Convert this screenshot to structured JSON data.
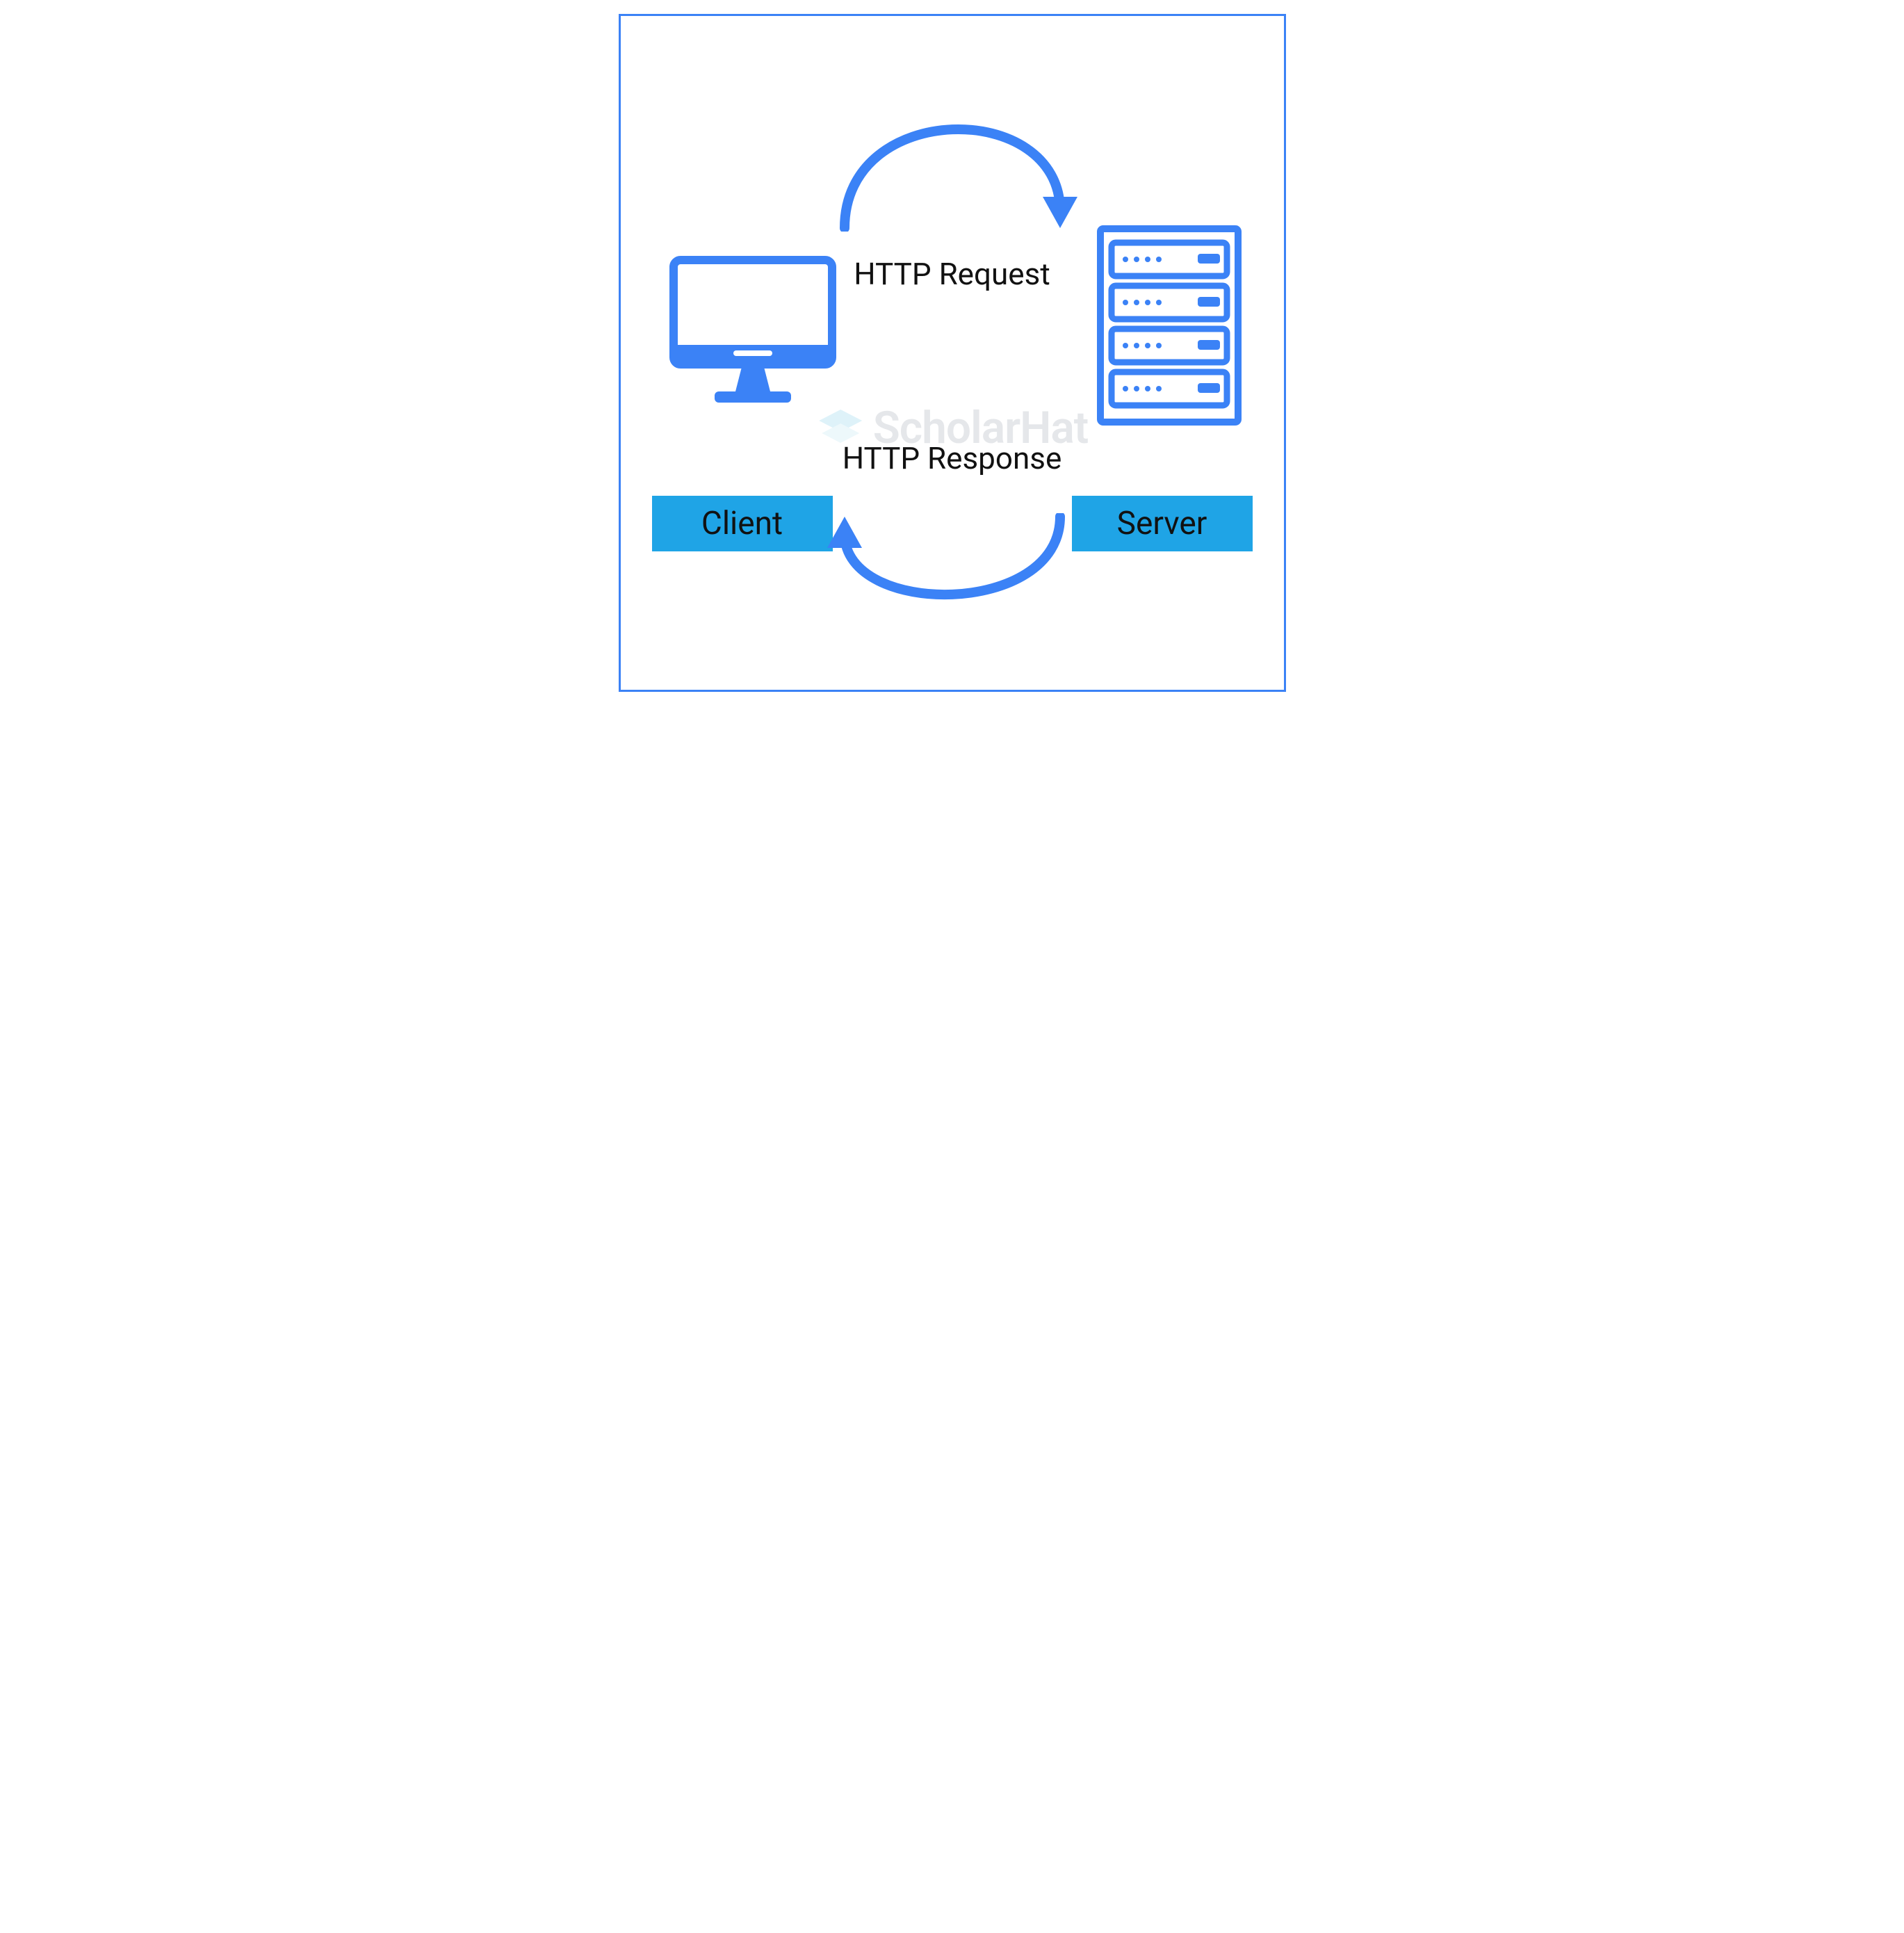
{
  "labels": {
    "request": "HTTP Request",
    "response": "HTTP Response",
    "client": "Client",
    "server": "Server"
  },
  "watermark": {
    "text": "ScholarHat"
  },
  "icons": {
    "client": "monitor-icon",
    "server": "server-rack-icon",
    "arrow_top": "request-arrow-icon",
    "arrow_bottom": "response-arrow-icon",
    "logo": "scholarhat-logo-icon"
  },
  "colors": {
    "primary": "#3b82f6",
    "box": "#1fa4e6",
    "text": "#111"
  }
}
